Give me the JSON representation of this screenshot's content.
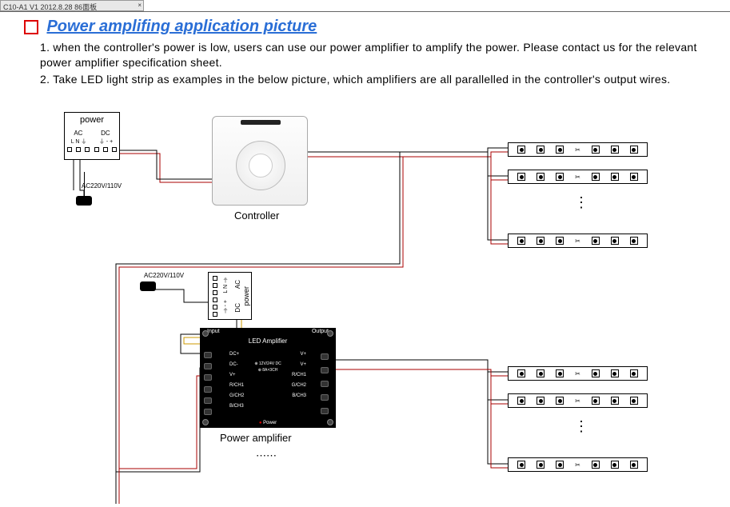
{
  "titlebar": {
    "text": "C10-A1 V1 2012.8.28 86面板",
    "close": "×"
  },
  "heading": "Power amplifing application picture",
  "body": {
    "item1": "1. when the controller's power is low, users can use our power amplifier to amplify the power. Please contact us for the relevant power amplifier specification sheet.",
    "item2": "2. Take LED light strip as examples in the below picture, which amplifiers are all parallelled in the controller's output wires."
  },
  "power1": {
    "title": "power",
    "ac": "AC",
    "dc": "DC",
    "pins_ac": "L N ⏚",
    "pins_dc": "⏚ - +",
    "ac_label": "AC220V/110V"
  },
  "controller": {
    "label": "Controller"
  },
  "power2": {
    "title": "power",
    "ac": "AC",
    "dc": "DC",
    "pins_ac": "L N ⏚",
    "pins_dc": "⏚ - +",
    "ac_label": "AC220V/110V"
  },
  "amplifier": {
    "label": "Power amplifier",
    "inout_l": "Input",
    "inout_r": "Output",
    "title": "LED Amplifier",
    "left_terms": [
      "DC+",
      "DC-",
      "V+",
      "R/CH1",
      "G/CH2",
      "B/CH3"
    ],
    "right_terms": [
      "V+",
      "V+",
      "R/CH1",
      "G/CH2",
      "B/CH3"
    ],
    "center": [
      "⊕ 12V/24V DC",
      "⊕ 8A×3CH"
    ],
    "power_led": "Power"
  },
  "ellipsis": "⋮"
}
